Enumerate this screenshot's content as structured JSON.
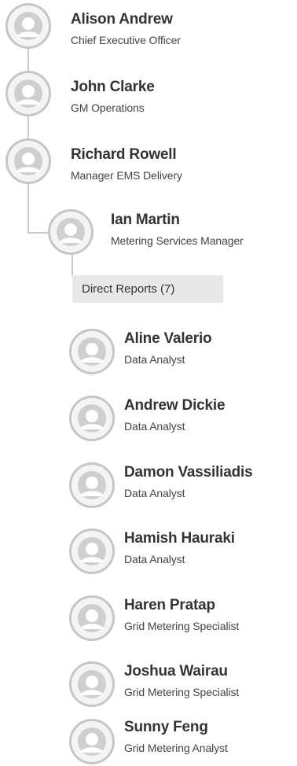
{
  "managers": [
    {
      "name": "Alison Andrew",
      "title": "Chief Executive Officer"
    },
    {
      "name": "John Clarke",
      "title": "GM Operations"
    },
    {
      "name": "Richard Rowell",
      "title": "Manager EMS Delivery"
    },
    {
      "name": "Ian Martin",
      "title": "Metering Services Manager"
    }
  ],
  "direct_reports_label": "Direct Reports (7)",
  "reports": [
    {
      "name": "Aline Valerio",
      "title": "Data Analyst"
    },
    {
      "name": "Andrew Dickie",
      "title": "Data Analyst"
    },
    {
      "name": "Damon Vassiliadis",
      "title": "Data Analyst"
    },
    {
      "name": "Hamish Hauraki",
      "title": "Data Analyst"
    },
    {
      "name": "Haren Pratap",
      "title": "Grid Metering Specialist"
    },
    {
      "name": "Joshua Wairau",
      "title": "Grid Metering Specialist"
    },
    {
      "name": "Sunny Feng",
      "title": "Grid Metering Analyst"
    }
  ],
  "icons": {
    "avatar": "person-placeholder-icon"
  },
  "colors": {
    "connector": "#c8c8c8",
    "avatar_border": "#c6c6c6",
    "direct_reports_bg": "#e8e8e8"
  }
}
